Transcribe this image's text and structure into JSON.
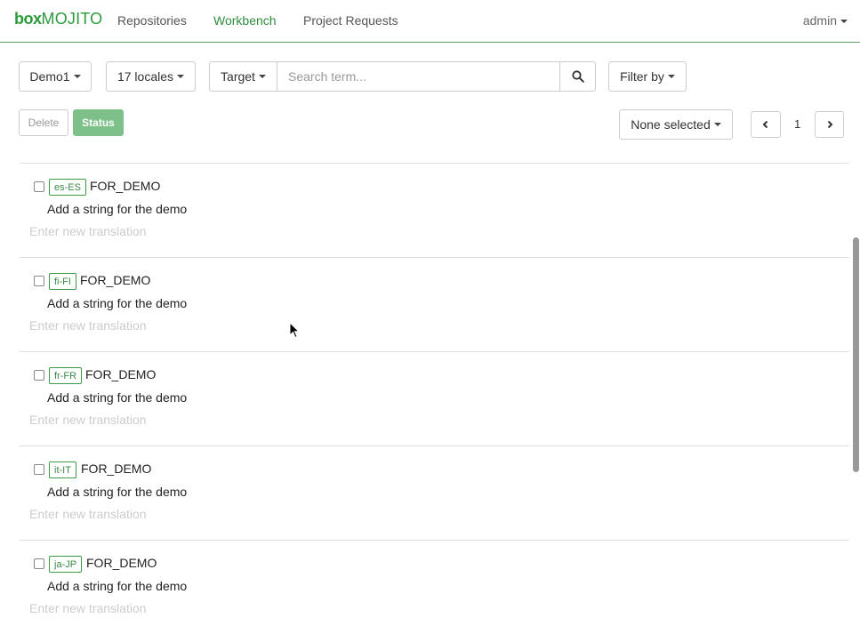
{
  "navbar": {
    "logo_box": "box",
    "logo_mojito": "MOJITO",
    "items": [
      {
        "label": "Repositories",
        "active": false
      },
      {
        "label": "Workbench",
        "active": true
      },
      {
        "label": "Project Requests",
        "active": false
      }
    ],
    "user": "admin"
  },
  "toolbar": {
    "repository": "Demo1",
    "locales": "17 locales",
    "search_scope": "Target",
    "search_placeholder": "Search term...",
    "filter": "Filter by",
    "delete_label": "Delete",
    "status_label": "Status",
    "selection": "None selected",
    "page": "1"
  },
  "rows": [
    {
      "locale": "es-ES",
      "key": "FOR_DEMO",
      "source": "Add a string for the demo",
      "target_placeholder": "Enter new translation"
    },
    {
      "locale": "fi-FI",
      "key": "FOR_DEMO",
      "source": "Add a string for the demo",
      "target_placeholder": "Enter new translation"
    },
    {
      "locale": "fr-FR",
      "key": "FOR_DEMO",
      "source": "Add a string for the demo",
      "target_placeholder": "Enter new translation"
    },
    {
      "locale": "it-IT",
      "key": "FOR_DEMO",
      "source": "Add a string for the demo",
      "target_placeholder": "Enter new translation"
    },
    {
      "locale": "ja-JP",
      "key": "FOR_DEMO",
      "source": "Add a string for the demo",
      "target_placeholder": "Enter new translation"
    }
  ],
  "colors": {
    "brand": "#2a9a3a",
    "status_button": "#7dc08a"
  }
}
